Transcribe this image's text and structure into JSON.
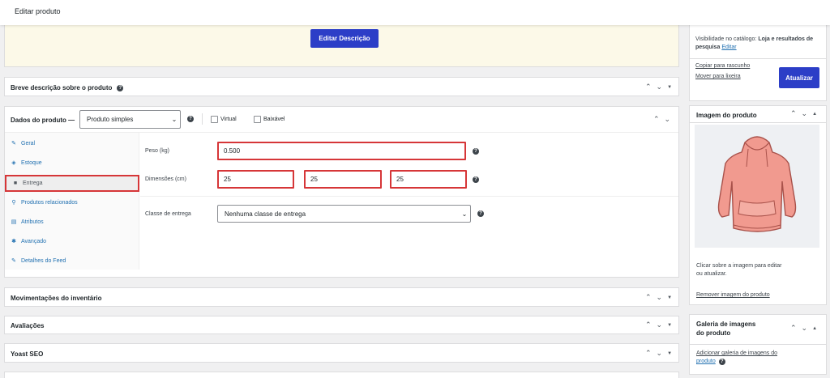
{
  "header": {
    "title": "Editar produto"
  },
  "description": {
    "edit_button": "Editar Descrição"
  },
  "short_description": {
    "title": "Breve descrição sobre o produto"
  },
  "product_data": {
    "title": "Dados do produto —",
    "type_selected": "Produto simples",
    "virtual_label": "Virtual",
    "downloadable_label": "Baixável",
    "tabs": [
      {
        "label": "Geral",
        "icon": "wrench-icon"
      },
      {
        "label": "Estoque",
        "icon": "tag-icon"
      },
      {
        "label": "Entrega",
        "icon": "truck-icon"
      },
      {
        "label": "Produtos relacionados",
        "icon": "link-icon"
      },
      {
        "label": "Atributos",
        "icon": "list-icon"
      },
      {
        "label": "Avançado",
        "icon": "gear-icon"
      },
      {
        "label": "Detalhes do Feed",
        "icon": "wrench-icon"
      }
    ],
    "active_tab": "Entrega",
    "shipping": {
      "weight_label": "Peso (kg)",
      "weight_value": "0.500",
      "dimensions_label": "Dimensões (cm)",
      "length": "25",
      "width": "25",
      "height": "25",
      "class_label": "Classe de entrega",
      "class_value": "Nenhuma classe de entrega"
    }
  },
  "panels": {
    "inventory": "Movimentações do inventário",
    "reviews": "Avaliações",
    "yoast": "Yoast SEO"
  },
  "publish": {
    "visibility_label": "Visibilidade no catálogo:",
    "visibility_value": "Loja e resultados de pesquisa",
    "visibility_edit": "Editar",
    "copy_draft": "Copiar para rascunho",
    "move_trash": "Mover para lixeira",
    "update_button": "Atualizar"
  },
  "product_image": {
    "title": "Imagem do produto",
    "hint_line1": "Clicar sobre a imagem para editar",
    "hint_line2": "ou atualizar.",
    "remove_link": "Remover imagem do produto"
  },
  "gallery": {
    "title_line1": "Galeria de imagens",
    "title_line2": "do produto",
    "add_link_line1": "Adicionar galeria de imagens do",
    "add_link_line2": "produto"
  },
  "colors": {
    "primary": "#2c3ec7",
    "highlight": "#d63638",
    "link": "#2271b1",
    "notice_bg": "#fcf9e8"
  }
}
